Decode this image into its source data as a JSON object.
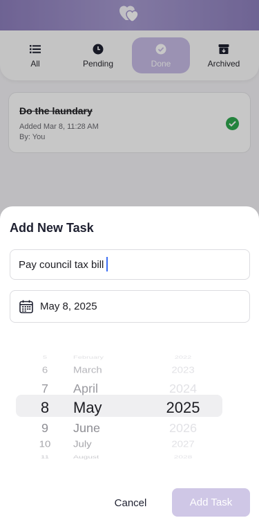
{
  "header": {
    "logo_icon": "hearts-logo-icon",
    "background": "#9b8ec7"
  },
  "tabs": [
    {
      "label": "All",
      "icon": "list-icon",
      "active": false
    },
    {
      "label": "Pending",
      "icon": "clock-icon",
      "active": false
    },
    {
      "label": "Done",
      "icon": "check-circle-icon",
      "active": true
    },
    {
      "label": "Archived",
      "icon": "archive-box-icon",
      "active": false
    }
  ],
  "task": {
    "title": "Do the laundary",
    "added": "Added Mar 8, 11:28 AM",
    "by": "By: You",
    "status_icon": "check-circle-icon",
    "status_color": "#2fa84f"
  },
  "sheet": {
    "title": "Add New Task",
    "task_input_value": "Pay council tax bill",
    "date_value": "May 8, 2025",
    "cancel_label": "Cancel",
    "add_label": "Add Task",
    "add_button_color": "#cfc7e6"
  },
  "picker": {
    "days": [
      "5",
      "6",
      "7",
      "8",
      "9",
      "10",
      "11"
    ],
    "months": [
      "February",
      "March",
      "April",
      "May",
      "June",
      "July",
      "August"
    ],
    "years": [
      "2022",
      "2023",
      "2024",
      "2025",
      "2026",
      "2027",
      "2028"
    ],
    "selected": {
      "day": "8",
      "month": "May",
      "year": "2025"
    }
  }
}
